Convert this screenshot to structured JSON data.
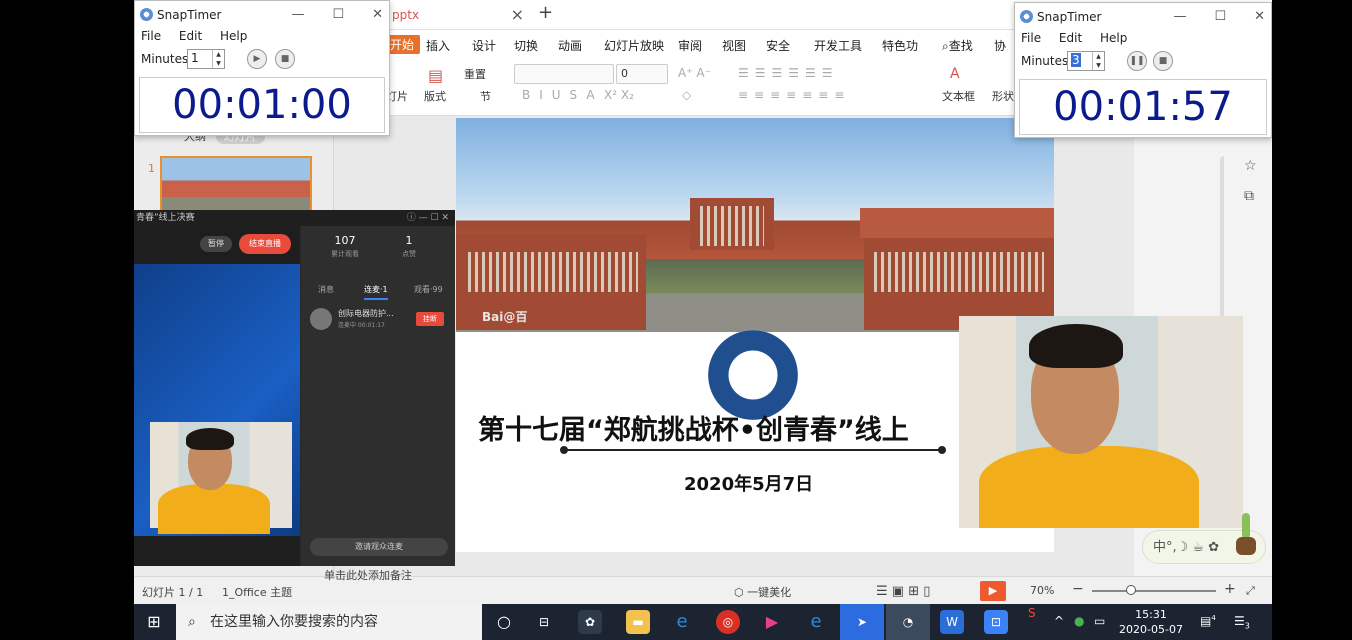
{
  "wps": {
    "doc_tab": "pptx",
    "menu": [
      "开始",
      "插入",
      "设计",
      "切换",
      "动画",
      "幻灯片放映",
      "审阅",
      "视图",
      "安全",
      "开发工具",
      "特色功",
      "查找",
      "协"
    ],
    "tools": {
      "slide": "灯片",
      "layout": "版式",
      "reset": "重置",
      "section": "节",
      "font_size": "0",
      "textbox": "文本框",
      "shape": "形状"
    },
    "outline_tabs": {
      "outline": "大纲",
      "slides": "幻灯片"
    },
    "slide_number": "1",
    "slide": {
      "title": "第十七届“郑航挑战杯•创青春”线上",
      "date": "2020年5月7日",
      "watermark": "Bai@百"
    },
    "status": {
      "slide_count": "幻灯片 1 / 1",
      "theme": "1_Office 主题",
      "notes_hint": "单击此处添加备注",
      "beautify": "一键美化",
      "zoom": "70%"
    }
  },
  "timer_left": {
    "title": "SnapTimer",
    "menu": [
      "File",
      "Edit",
      "Help"
    ],
    "minutes_label": "Minutes:",
    "minutes_value": "1",
    "display": "00:01:00"
  },
  "timer_right": {
    "title": "SnapTimer",
    "menu": [
      "File",
      "Edit",
      "Help"
    ],
    "minutes_label": "Minutes:",
    "minutes_value": "3",
    "display": "00:01:57"
  },
  "live": {
    "window_title": "青春”线上决赛",
    "pause": "暂停",
    "end_live": "结束直播",
    "stats": [
      {
        "value": "107",
        "label": "累计观看"
      },
      {
        "value": "1",
        "label": "点赞"
      }
    ],
    "tabs": [
      "消息",
      "连麦·1",
      "观看·99"
    ],
    "caller_name": "创际电器防护...",
    "caller_status": "连麦中 00:01:17",
    "hangup": "挂断",
    "clear": "邀请观众连麦"
  },
  "ime": {
    "text": "中°,☽ ☕ ✿"
  },
  "taskbar": {
    "search_placeholder": "在这里输入你要搜索的内容",
    "time": "15:31",
    "date": "2020-05-07",
    "notification_count": "3",
    "desktop_badge": "4"
  },
  "colors": {
    "wps_accent": "#e9702b",
    "timer_digits": "#0b1a8c",
    "live_end": "#e84a3c",
    "taskbar": "#1b2430"
  }
}
